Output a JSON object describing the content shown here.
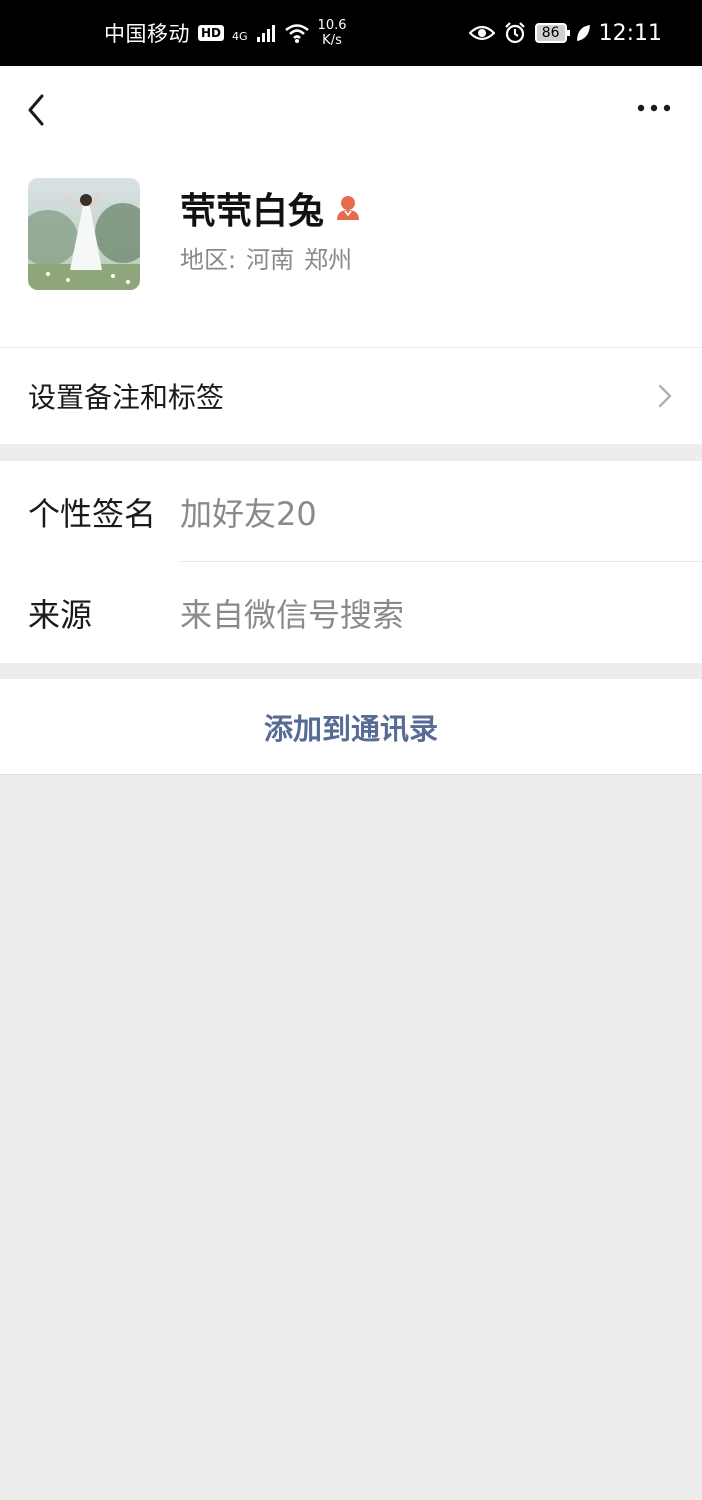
{
  "status_bar": {
    "carrier": "中国移动",
    "hd": "HD",
    "network": "4G",
    "speed_value": "10.6",
    "speed_unit": "K/s",
    "battery": "86",
    "time": "12:11"
  },
  "profile": {
    "nickname": "茕茕白兔",
    "region_label": "地区:",
    "region_province": "河南",
    "region_city": "郑州"
  },
  "remark_row": {
    "label": "设置备注和标签"
  },
  "info": {
    "signature_label": "个性签名",
    "signature_value": "加好友20",
    "source_label": "来源",
    "source_value": "来自微信号搜索"
  },
  "actions": {
    "add_contact": "添加到通讯录"
  },
  "colors": {
    "link": "#576b95",
    "gender_female": "#e56c4c",
    "background": "#ededed"
  },
  "icons": {
    "back": "chevron-left-icon",
    "more": "more-dots-icon",
    "gender": "female-gender-icon",
    "chevron": "chevron-right-icon"
  }
}
